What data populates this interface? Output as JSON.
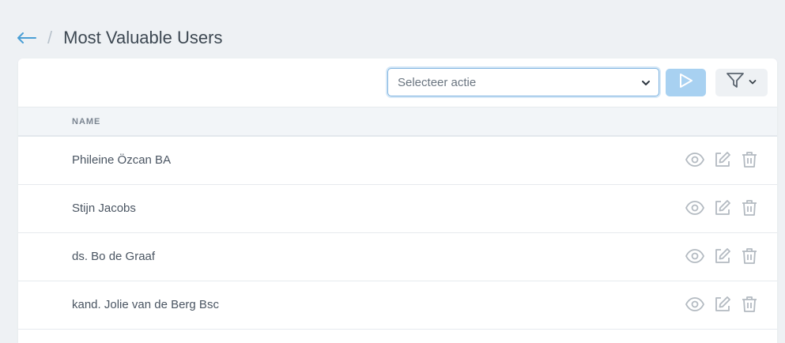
{
  "header": {
    "back_icon": "arrow-left-icon",
    "separator": "/",
    "title": "Most Valuable Users"
  },
  "toolbar": {
    "action_select": {
      "placeholder": "Selecteer actie",
      "icon": "chevron-down-icon"
    },
    "run_button_icon": "play-icon",
    "filter_button_icons": [
      "filter-icon",
      "chevron-down-icon"
    ]
  },
  "table": {
    "columns": [
      "NAME"
    ],
    "rows": [
      {
        "name": "Phileine Özcan BA"
      },
      {
        "name": "Stijn Jacobs"
      },
      {
        "name": "ds. Bo de Graaf"
      },
      {
        "name": "kand. Jolie van de Berg Bsc"
      }
    ],
    "row_action_icons": [
      "eye-icon",
      "edit-icon",
      "trash-icon"
    ]
  },
  "colors": {
    "accent": "#4a9fd5",
    "run_button": "#a8d1f1",
    "icon_gray": "#b3bac1",
    "background": "#eef1f4"
  }
}
